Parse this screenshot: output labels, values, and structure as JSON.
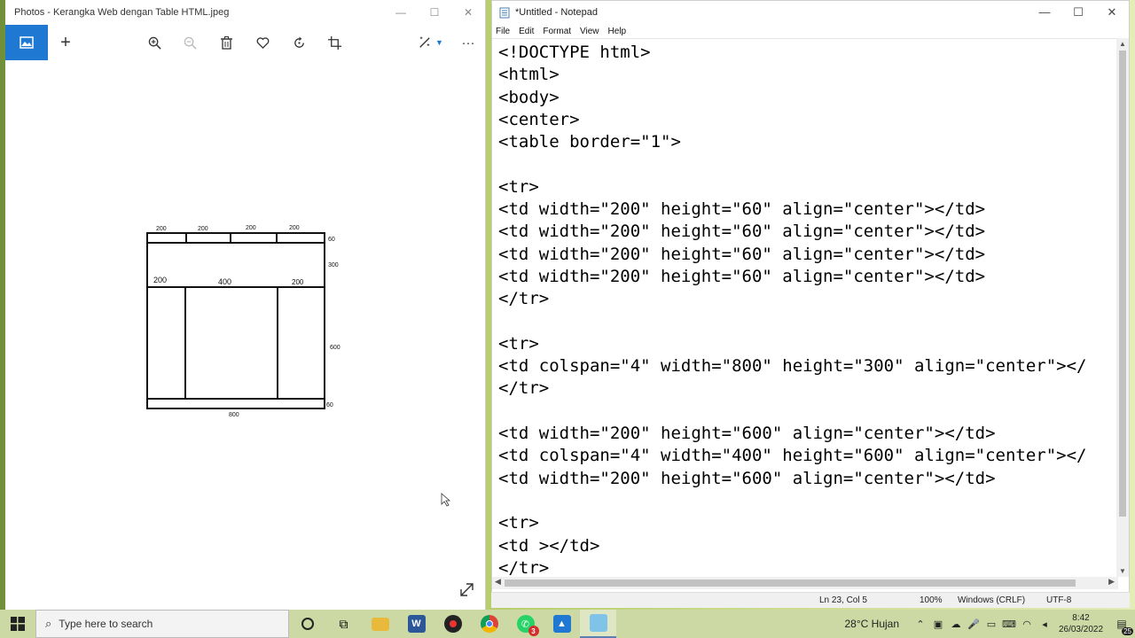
{
  "photos": {
    "title": "Photos - Kerangka Web dengan Table HTML.jpeg",
    "toolbar": {
      "view": "image-icon",
      "add": "+",
      "zoom_in": "zoom-in-icon",
      "zoom_out": "zoom-out-icon",
      "delete": "trash-icon",
      "favorite": "heart-icon",
      "rotate": "rotate-icon",
      "crop": "crop-icon",
      "edit": "edit-icon",
      "more": "···"
    },
    "sketch": {
      "top_cols": [
        "200",
        "200",
        "200",
        "200"
      ],
      "row1_height": "60",
      "row2_height": "300",
      "mid_labels": [
        "200",
        "400",
        "200"
      ],
      "row3_height": "600",
      "row4_height": "60",
      "total_width": "800"
    }
  },
  "notepad": {
    "title": "*Untitled - Notepad",
    "menu": [
      "File",
      "Edit",
      "Format",
      "View",
      "Help"
    ],
    "lines": [
      "<!DOCTYPE html>",
      "<html>",
      "<body>",
      "<center>",
      "<table border=\"1\">",
      "",
      "<tr>",
      "<td width=\"200\" height=\"60\" align=\"center\"></td>",
      "<td width=\"200\" height=\"60\" align=\"center\"></td>",
      "<td width=\"200\" height=\"60\" align=\"center\"></td>",
      "<td width=\"200\" height=\"60\" align=\"center\"></td>",
      "</tr>",
      "",
      "<tr>",
      "<td colspan=\"4\" width=\"800\" height=\"300\" align=\"center\"></",
      "</tr>",
      "",
      "<td width=\"200\" height=\"600\" align=\"center\"></td>",
      "<td colspan=\"4\" width=\"400\" height=\"600\" align=\"center\"></",
      "<td width=\"200\" height=\"600\" align=\"center\"></td>",
      "",
      "<tr>",
      "<td ></td>",
      "</tr>"
    ],
    "status": {
      "position": "Ln 23, Col 5",
      "zoom": "100%",
      "eol": "Windows (CRLF)",
      "encoding": "UTF-8"
    }
  },
  "taskbar": {
    "search_placeholder": "Type here to search",
    "weather": "28°C  Hujan",
    "time": "8:42",
    "date": "26/03/2022",
    "notifications": "25",
    "whatsapp_badge": "3"
  }
}
